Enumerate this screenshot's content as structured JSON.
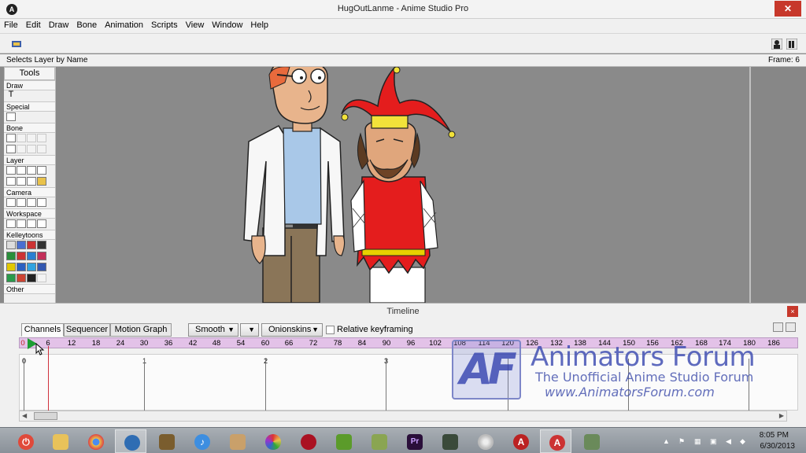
{
  "window": {
    "title": "HugOutLanme - Anime Studio Pro",
    "app_icon": "anime-studio-icon",
    "close_glyph": "✕"
  },
  "menu": [
    "File",
    "Edit",
    "Draw",
    "Bone",
    "Animation",
    "Scripts",
    "View",
    "Window",
    "Help"
  ],
  "status": {
    "text": "Selects Layer by Name",
    "frame": "Frame: 6"
  },
  "tools": {
    "header": "Tools",
    "sections": [
      "Draw",
      "Special",
      "Bone",
      "Layer",
      "Camera",
      "Workspace",
      "Kelleytoons",
      "Other"
    ],
    "text_tool_glyph": "T"
  },
  "timeline": {
    "title": "Timeline",
    "close_glyph": "×",
    "tabs": [
      "Channels",
      "Sequencer",
      "Motion Graph"
    ],
    "smooth_label": "Smooth",
    "onionskins_label": "Onionskins",
    "relative_keyframing_label": "Relative keyframing",
    "ruler_start": "0",
    "ruler_numbers": [
      "6",
      "12",
      "18",
      "24",
      "30",
      "36",
      "42",
      "48",
      "54",
      "60",
      "66",
      "72",
      "78",
      "84",
      "90",
      "96",
      "102",
      "108",
      "114",
      "120",
      "126",
      "132",
      "138",
      "144",
      "150",
      "156",
      "162",
      "168",
      "174",
      "180",
      "186"
    ],
    "seconds": [
      "0",
      "1",
      "2",
      "3"
    ]
  },
  "watermark": {
    "logo_text": "AF",
    "title": "Animators Forum",
    "subtitle": "The Unofficial Anime Studio Forum",
    "url": "www.AnimatorsForum.com"
  },
  "taskbar": {
    "time": "8:05 PM",
    "date": "6/30/2013",
    "apps": [
      "power-icon",
      "file-explorer-icon",
      "chrome-icon",
      "thunderbird-icon",
      "app-icon",
      "itunes-icon",
      "paint-icon",
      "picasa-icon",
      "red-app-icon",
      "green-app-icon",
      "game-icon",
      "premiere-icon",
      "terminal-icon",
      "dvd-icon",
      "anime-studio-icon",
      "anime-studio-pro-icon",
      "media-icon"
    ]
  }
}
